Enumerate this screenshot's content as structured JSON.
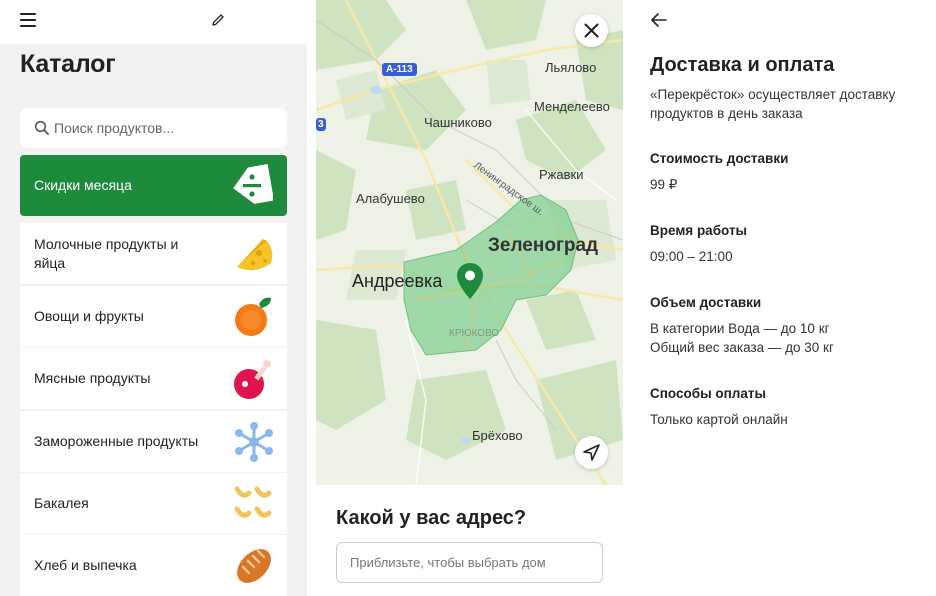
{
  "catalog": {
    "title": "Каталог",
    "search_placeholder": "Поиск продуктов...",
    "categories": [
      {
        "label": "Скидки месяца",
        "icon": "discount-tag-icon",
        "active": true
      },
      {
        "label": "Молочные продукты и яйца",
        "icon": "cheese-icon"
      },
      {
        "label": "Овощи и фрукты",
        "icon": "orange-icon"
      },
      {
        "label": "Мясные продукты",
        "icon": "ham-icon"
      },
      {
        "label": "Замороженные продукты",
        "icon": "snowflake-icon"
      },
      {
        "label": "Бакалея",
        "icon": "pasta-icon"
      },
      {
        "label": "Хлеб и выпечка",
        "icon": "bread-icon"
      }
    ]
  },
  "map": {
    "places": {
      "lyalovo": "Льялово",
      "mendeleevo": "Менделеево",
      "chashnikovo": "Чашниково",
      "rzhavki": "Ржавки",
      "alabushevo": "Алабушево",
      "zelenograd": "Зеленоград",
      "andreevka": "Андреевка",
      "kryukovo": "КРЮКОВО",
      "brekhovo": "Брёхово",
      "highway": "Ленинградское ш."
    },
    "road_badges": [
      "А-113",
      "3"
    ]
  },
  "address": {
    "title": "Какой у вас адрес?",
    "placeholder": "Приблизьте, чтобы выбрать дом"
  },
  "delivery": {
    "title": "Доставка и оплата",
    "description": "«Перекрёсток» осуществляет доставку продуктов в день заказа",
    "cost_heading": "Стоимость доставки",
    "cost_value": "99 ₽",
    "hours_heading": "Время работы",
    "hours_value": "09:00 – 21:00",
    "volume_heading": "Объем доставки",
    "volume_line1": "В категории Вода — до 10 кг",
    "volume_line2": "Общий вес заказа — до 30 кг",
    "payment_heading": "Способы оплаты",
    "payment_value": "Только картой онлайн"
  },
  "colors": {
    "brand_green": "#1e8a3c",
    "zone_green": "#7fcf8f"
  }
}
